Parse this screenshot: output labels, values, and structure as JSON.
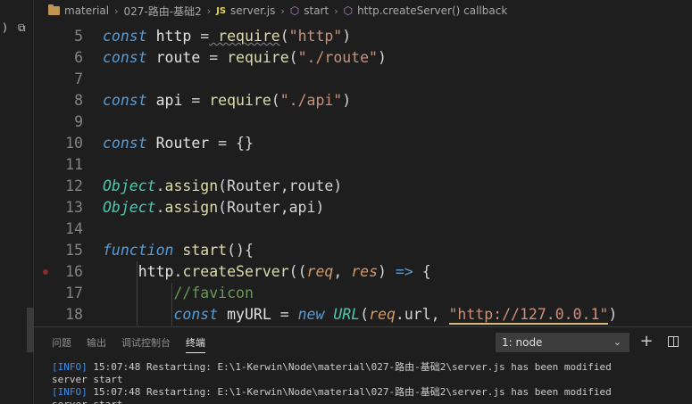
{
  "breadcrumb": {
    "items": [
      "material",
      "027-路由-基础2",
      "server.js",
      "start",
      "http.createServer() callback"
    ],
    "js_badge": "JS"
  },
  "side_strip": {
    "glyph_a": ")",
    "glyph_b": "⧉"
  },
  "editor": {
    "lines": [
      {
        "n": "5",
        "tokens": [
          [
            "kw",
            "const"
          ],
          [
            "id",
            " http "
          ],
          [
            "op",
            "="
          ],
          [
            "fn",
            " require"
          ],
          [
            "pn",
            "("
          ],
          [
            "str",
            "\"http\""
          ],
          [
            "pn",
            ")"
          ]
        ]
      },
      {
        "n": "6",
        "tokens": [
          [
            "kw",
            "const"
          ],
          [
            "id",
            " route "
          ],
          [
            "op",
            "="
          ],
          [
            "fn",
            " require"
          ],
          [
            "pn",
            "("
          ],
          [
            "str",
            "\"./route\""
          ],
          [
            "pn",
            ")"
          ]
        ]
      },
      {
        "n": "7",
        "tokens": []
      },
      {
        "n": "8",
        "tokens": [
          [
            "kw",
            "const"
          ],
          [
            "id",
            " api "
          ],
          [
            "op",
            "="
          ],
          [
            "fn",
            " require"
          ],
          [
            "pn",
            "("
          ],
          [
            "str",
            "\"./api\""
          ],
          [
            "pn",
            ")"
          ]
        ]
      },
      {
        "n": "9",
        "tokens": []
      },
      {
        "n": "10",
        "tokens": [
          [
            "kw",
            "const"
          ],
          [
            "id",
            " Router "
          ],
          [
            "op",
            "="
          ],
          [
            "pn",
            " {}"
          ]
        ]
      },
      {
        "n": "11",
        "tokens": []
      },
      {
        "n": "12",
        "tokens": [
          [
            "obj",
            "Object"
          ],
          [
            "pn",
            "."
          ],
          [
            "fn",
            "assign"
          ],
          [
            "pn",
            "(Router,route)"
          ]
        ]
      },
      {
        "n": "13",
        "tokens": [
          [
            "obj",
            "Object"
          ],
          [
            "pn",
            "."
          ],
          [
            "fn",
            "assign"
          ],
          [
            "pn",
            "(Router,api)"
          ]
        ]
      },
      {
        "n": "14",
        "tokens": []
      },
      {
        "n": "15",
        "tokens": [
          [
            "kw",
            "function"
          ],
          [
            "fn",
            " start"
          ],
          [
            "pn",
            "(){"
          ]
        ]
      },
      {
        "n": "16",
        "tokens": [
          [
            "pn",
            "    "
          ],
          [
            "id",
            "http"
          ],
          [
            "pn",
            "."
          ],
          [
            "fn",
            "createServer"
          ],
          [
            "pn",
            "(("
          ],
          [
            "par",
            "req"
          ],
          [
            "pn",
            ", "
          ],
          [
            "par",
            "res"
          ],
          [
            "pn",
            ") "
          ],
          [
            "kw",
            "=>"
          ],
          [
            "pn",
            " {"
          ]
        ]
      },
      {
        "n": "17",
        "tokens": [
          [
            "pn",
            "        "
          ],
          [
            "cm",
            "//favicon"
          ]
        ]
      },
      {
        "n": "18",
        "tokens": [
          [
            "pn",
            "        "
          ],
          [
            "kw",
            "const"
          ],
          [
            "id",
            " myURL "
          ],
          [
            "op",
            "="
          ],
          [
            "kw",
            " new"
          ],
          [
            "ctor",
            " URL"
          ],
          [
            "pn",
            "("
          ],
          [
            "par",
            "req"
          ],
          [
            "pn",
            ".url, "
          ],
          [
            "str-link",
            "\"http://127.0.0.1\""
          ],
          [
            "pn",
            ")"
          ]
        ]
      }
    ]
  },
  "panel": {
    "tabs": [
      "问题",
      "输出",
      "调试控制台",
      "终端"
    ],
    "active_tab": "终端",
    "terminal_select": "1: node",
    "add_button": "+",
    "terminal_lines": [
      {
        "tag": "[INFO]",
        "text": " 15:07:48 Restarting: E:\\1-Kerwin\\Node\\material\\027-路由-基础2\\server.js has been modified"
      },
      {
        "tag": "",
        "text": "server start"
      },
      {
        "tag": "[INFO]",
        "text": " 15:07:48 Restarting: E:\\1-Kerwin\\Node\\material\\027-路由-基础2\\server.js has been modified"
      },
      {
        "tag": "",
        "text": "server start"
      }
    ]
  }
}
